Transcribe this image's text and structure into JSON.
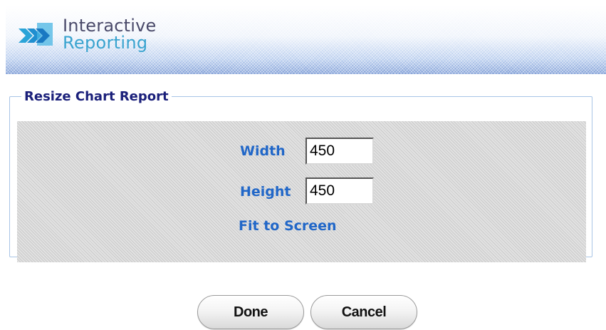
{
  "header": {
    "brand_line1": "Interactive",
    "brand_line2": "Reporting",
    "logo_icon": "interactive-reporting-logo-icon"
  },
  "panel": {
    "title": "Resize Chart Report",
    "width_label": "Width",
    "width_value": "450",
    "height_label": "Height",
    "height_value": "450",
    "fit_link": "Fit to Screen"
  },
  "buttons": {
    "done_label": "Done",
    "cancel_label": "Cancel"
  },
  "colors": {
    "title": "#1a1f7a",
    "label": "#2167c8",
    "brand_dark": "#4a4a6a",
    "brand_light": "#39a3cf"
  }
}
